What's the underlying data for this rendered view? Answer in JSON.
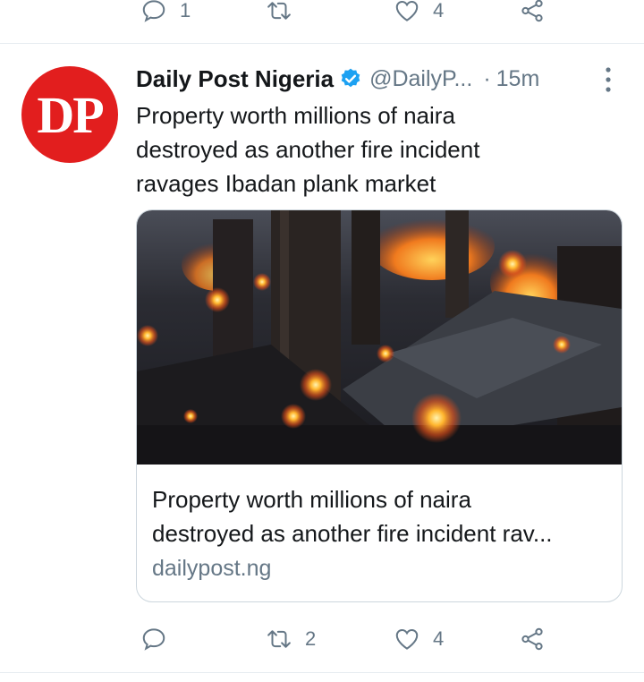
{
  "prev_tweet": {
    "actions": {
      "reply_count": "1",
      "retweet_count": "",
      "like_count": "4",
      "share_count": ""
    }
  },
  "tweet": {
    "author_name": "Daily Post Nigeria",
    "author_handle": "@DailyP...",
    "time_separator": "·",
    "time": "15m",
    "avatar_text": "DP",
    "text_lines": [
      "Property worth millions of naira",
      "destroyed as another fire incident",
      "ravages Ibadan plank market"
    ],
    "card": {
      "title_lines": [
        "Property worth millions of naira",
        "destroyed as another fire incident rav..."
      ],
      "domain": "dailypost.ng"
    },
    "actions": {
      "reply_count": "",
      "retweet_count": "2",
      "like_count": "4",
      "share_count": ""
    }
  },
  "colors": {
    "avatar_bg": "#e21e1e",
    "verified": "#1da1f2",
    "secondary_text": "#657786",
    "divider": "#e6ecf0"
  }
}
